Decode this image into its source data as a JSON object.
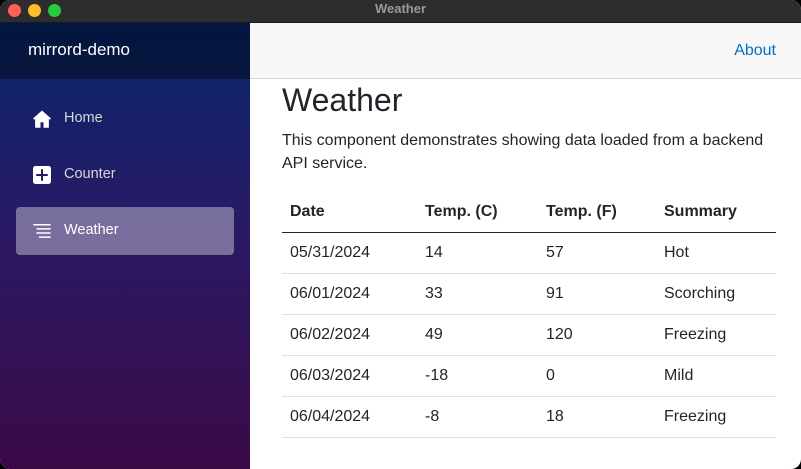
{
  "window": {
    "title": "Weather"
  },
  "sidebar": {
    "brand": "mirrord-demo",
    "items": [
      {
        "label": "Home",
        "icon": "house-icon",
        "active": false
      },
      {
        "label": "Counter",
        "icon": "plus-square-icon",
        "active": false
      },
      {
        "label": "Weather",
        "icon": "list-icon",
        "active": true
      }
    ]
  },
  "top_row": {
    "about_label": "About"
  },
  "page": {
    "title": "Weather",
    "description": "This component demonstrates showing data loaded from a backend API service."
  },
  "table": {
    "headers": [
      "Date",
      "Temp. (C)",
      "Temp. (F)",
      "Summary"
    ],
    "rows": [
      [
        "05/31/2024",
        "14",
        "57",
        "Hot"
      ],
      [
        "06/01/2024",
        "33",
        "91",
        "Scorching"
      ],
      [
        "06/02/2024",
        "49",
        "120",
        "Freezing"
      ],
      [
        "06/03/2024",
        "-18",
        "0",
        "Mild"
      ],
      [
        "06/04/2024",
        "-8",
        "18",
        "Freezing"
      ]
    ]
  },
  "colors": {
    "link": "#0071c1",
    "sidebar_top": "#05276b",
    "sidebar_bottom": "#3a0a47",
    "traffic_close": "#fe5f57",
    "traffic_minimize": "#febc2e",
    "traffic_maximize": "#28c840"
  }
}
